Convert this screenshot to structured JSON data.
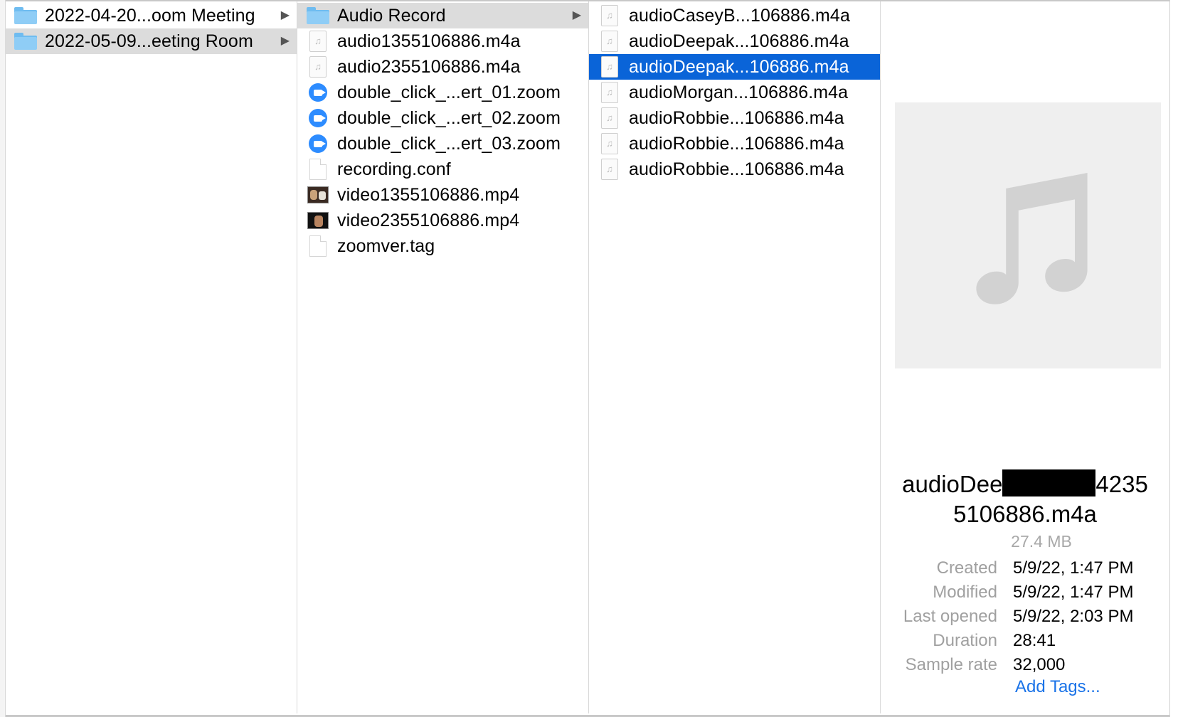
{
  "column1": {
    "items": [
      {
        "label": "2022-04-20...oom Meeting",
        "icon": "folder-icon",
        "has_arrow": true
      },
      {
        "label": "2022-05-09...eeting Room",
        "icon": "folder-icon",
        "has_arrow": true
      }
    ]
  },
  "column2": {
    "items": [
      {
        "label": "Audio Record",
        "icon": "folder-icon",
        "has_arrow": true
      },
      {
        "label": "audio1355106886.m4a",
        "icon": "audio-file-icon"
      },
      {
        "label": "audio2355106886.m4a",
        "icon": "audio-file-icon"
      },
      {
        "label": "double_click_...ert_01.zoom",
        "icon": "zoom-icon"
      },
      {
        "label": "double_click_...ert_02.zoom",
        "icon": "zoom-icon"
      },
      {
        "label": "double_click_...ert_03.zoom",
        "icon": "zoom-icon"
      },
      {
        "label": "recording.conf",
        "icon": "document-icon"
      },
      {
        "label": "video1355106886.mp4",
        "icon": "video-thumbnail-icon"
      },
      {
        "label": "video2355106886.mp4",
        "icon": "video-thumbnail-icon"
      },
      {
        "label": "zoomver.tag",
        "icon": "document-icon"
      }
    ]
  },
  "column3": {
    "items": [
      {
        "label": "audioCaseyB...106886.m4a",
        "icon": "audio-file-icon"
      },
      {
        "label": "audioDeepak...106886.m4a",
        "icon": "audio-file-icon"
      },
      {
        "label": "audioDeepak...106886.m4a",
        "icon": "audio-file-icon",
        "selected": true
      },
      {
        "label": "audioMorgan...106886.m4a",
        "icon": "audio-file-icon"
      },
      {
        "label": "audioRobbie...106886.m4a",
        "icon": "audio-file-icon"
      },
      {
        "label": "audioRobbie...106886.m4a",
        "icon": "audio-file-icon"
      },
      {
        "label": "audioRobbie...106886.m4a",
        "icon": "audio-file-icon"
      }
    ]
  },
  "preview": {
    "art_icon": "music-note-icon",
    "filename_start": "audioDee",
    "filename_end": "4235",
    "filename_line2": "5106886.m4a",
    "size": "27.4 MB",
    "metadata": [
      {
        "key": "Created",
        "value": "5/9/22, 1:47 PM"
      },
      {
        "key": "Modified",
        "value": "5/9/22, 1:47 PM"
      },
      {
        "key": "Last opened",
        "value": "5/9/22, 2:03 PM"
      },
      {
        "key": "Duration",
        "value": "28:41"
      },
      {
        "key": "Sample rate",
        "value": "32,000"
      }
    ],
    "add_tags": "Add Tags..."
  },
  "colors": {
    "selection": "#0a64d8",
    "parent_selection": "#dcdcdc",
    "link": "#1a73e8"
  }
}
